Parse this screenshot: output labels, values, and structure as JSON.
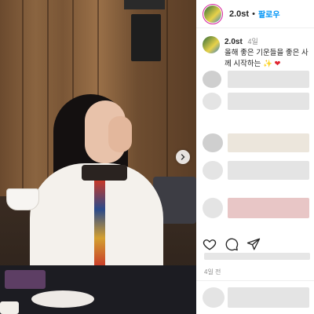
{
  "post": {
    "username": "2.0st",
    "follow_label": "팔로우",
    "dot": "•",
    "caption_user": "2.0st",
    "caption_time": "4일",
    "caption_line1": "올해 좋은 기운들을 좋은 사",
    "caption_line2": "께 시작하는",
    "spark_emoji": "✨",
    "heart_emoji": "❤",
    "post_age": "4일 전"
  },
  "icons": {
    "like": "heart-icon",
    "comment": "comment-icon",
    "share": "send-icon",
    "carousel_next": "chevron-right-icon"
  },
  "colors": {
    "follow": "#0095f6",
    "ring": "#d6249f",
    "heart": "#e0242f"
  }
}
